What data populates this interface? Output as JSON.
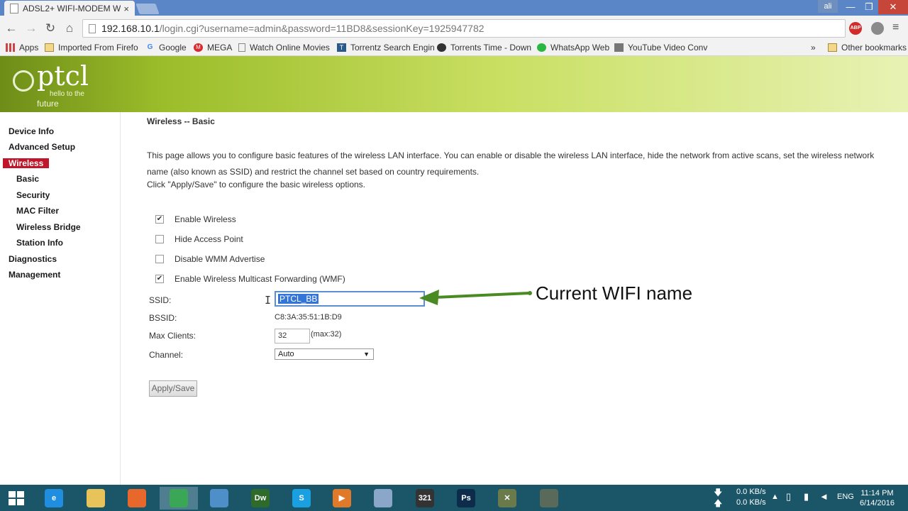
{
  "browser": {
    "tab_title": "ADSL2+ WIFI-MODEM W",
    "tab_close": "×",
    "user": "ali",
    "win_min": "—",
    "win_max": "❐",
    "win_close": "✕",
    "url_host": "192.168.10.1",
    "url_path": "/login.cgi?username=admin&password=11BD8&sessionKey=1925947782",
    "back": "←",
    "forward": "→",
    "reload": "↻",
    "home": "⌂",
    "star": "☆",
    "abp": "ABP",
    "menu": "≡"
  },
  "bookmarks": {
    "items": [
      {
        "label": "Apps",
        "icon": "apps-icon"
      },
      {
        "label": "Imported From Firefo",
        "icon": "folder-icon"
      },
      {
        "label": "Google",
        "icon": "google-icon"
      },
      {
        "label": "MEGA",
        "icon": "mega-icon"
      },
      {
        "label": "Watch Online Movies",
        "icon": "page-icon"
      },
      {
        "label": "Torrentz Search Engin",
        "icon": "torrentz-icon"
      },
      {
        "label": "Torrents Time - Down",
        "icon": "torrents-time-icon"
      },
      {
        "label": "WhatsApp Web",
        "icon": "whatsapp-icon"
      },
      {
        "label": "YouTube Video Conv",
        "icon": "youtube-converter-icon"
      }
    ],
    "overflow": "»",
    "other": "Other bookmarks"
  },
  "logo": {
    "name": "ptcl",
    "tagline1": "hello to the",
    "tagline2": "future"
  },
  "sidebar": {
    "items": [
      {
        "label": "Device Info"
      },
      {
        "label": "Advanced Setup"
      },
      {
        "label": "Wireless"
      },
      {
        "label": "Basic"
      },
      {
        "label": "Security"
      },
      {
        "label": "MAC Filter"
      },
      {
        "label": "Wireless Bridge"
      },
      {
        "label": "Station Info"
      },
      {
        "label": "Diagnostics"
      },
      {
        "label": "Management"
      }
    ]
  },
  "content": {
    "title": "Wireless -- Basic",
    "description": "This page allows you to configure basic features of the wireless LAN interface. You can enable or disable the wireless LAN interface, hide the network from active scans, set the wireless network name (also known as SSID) and restrict the channel set based on country requirements.",
    "instruction": "Click \"Apply/Save\" to configure the basic wireless options.",
    "checkboxes": [
      {
        "label": "Enable Wireless",
        "checked": true,
        "mark": "✔"
      },
      {
        "label": "Hide Access Point",
        "checked": false,
        "mark": ""
      },
      {
        "label": "Disable WMM Advertise",
        "checked": false,
        "mark": ""
      },
      {
        "label": "Enable Wireless Multicast Forwarding (WMF)",
        "checked": true,
        "mark": "✔"
      }
    ],
    "ssid_label": "SSID:",
    "ssid_value": "PTCL_BB",
    "bssid_label": "BSSID:",
    "bssid_value": "C8:3A:35:51:1B:D9",
    "max_clients_label": "Max Clients:",
    "max_clients_value": "32",
    "max_clients_note": "(max:32)",
    "channel_label": "Channel:",
    "channel_value": "Auto",
    "apply_label": "Apply/Save"
  },
  "annotation": {
    "text": "Current WIFI name",
    "color": "#4a8a22"
  },
  "taskbar": {
    "apps": [
      {
        "name": "internet-explorer-icon",
        "glyph": "e",
        "color": "#1f8ee0"
      },
      {
        "name": "file-explorer-icon",
        "glyph": "",
        "color": "#e8c35a"
      },
      {
        "name": "firefox-icon",
        "glyph": "",
        "color": "#e8672a"
      },
      {
        "name": "chrome-icon",
        "glyph": "",
        "color": "#3aa757"
      },
      {
        "name": "control-panel-icon",
        "glyph": "",
        "color": "#4f8fc9"
      },
      {
        "name": "dreamweaver-icon",
        "glyph": "Dw",
        "color": "#2e6a2a"
      },
      {
        "name": "skype-icon",
        "glyph": "S",
        "color": "#1aa0e0"
      },
      {
        "name": "media-player-icon",
        "glyph": "▶",
        "color": "#e0792a"
      },
      {
        "name": "paint-icon",
        "glyph": "",
        "color": "#8aa6c8"
      },
      {
        "name": "video-editor-icon",
        "glyph": "321",
        "color": "#333333"
      },
      {
        "name": "photoshop-icon",
        "glyph": "Ps",
        "color": "#0d2b4a"
      },
      {
        "name": "app-x-icon",
        "glyph": "✕",
        "color": "#6a7a4a"
      },
      {
        "name": "app-y-icon",
        "glyph": "",
        "color": "#5a6a5a"
      }
    ],
    "net_down": "0.0 KB/s",
    "net_up": "0.0 KB/s",
    "lang": "ENG",
    "time": "11:14 PM",
    "date": "6/14/2016"
  }
}
